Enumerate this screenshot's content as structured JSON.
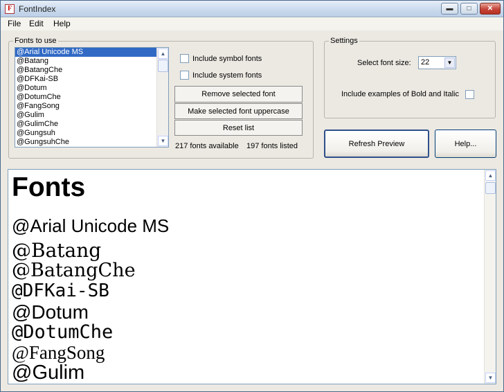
{
  "window": {
    "title": "FontIndex",
    "icon": "app-logo-icon",
    "min_glyph": "▬",
    "max_glyph": "□",
    "close_glyph": "✕"
  },
  "menu": {
    "items": [
      "File",
      "Edit",
      "Help"
    ]
  },
  "fonts_group": {
    "legend": "Fonts to use",
    "list": [
      "@Arial Unicode MS",
      "@Batang",
      "@BatangChe",
      "@DFKai-SB",
      "@Dotum",
      "@DotumChe",
      "@FangSong",
      "@Gulim",
      "@GulimChe",
      "@Gungsuh",
      "@GungsuhChe"
    ],
    "selected_index": 0,
    "include_symbol_label": "Include symbol fonts",
    "include_system_label": "Include system fonts",
    "remove_button": "Remove selected font",
    "uppercase_button": "Make selected font uppercase",
    "reset_button": "Reset list",
    "fonts_available": "217 fonts available",
    "fonts_listed": "197 fonts listed"
  },
  "settings_group": {
    "legend": "Settings",
    "font_size_label": "Select font size:",
    "font_size_value": "22",
    "bold_italic_label": "Include examples of Bold and Italic"
  },
  "actions": {
    "refresh_button": "Refresh Preview",
    "help_button": "Help..."
  },
  "preview": {
    "heading": "Fonts",
    "lines": [
      "@Arial Unicode MS",
      "@Batang",
      "@BatangChe",
      "@DFKai-SB",
      "@Dotum",
      "@DotumChe",
      "@FangSong",
      "@Gulim"
    ]
  },
  "colors": {
    "selection": "#316ac5",
    "window_bg": "#ece9e3",
    "border": "#7f9db9"
  }
}
